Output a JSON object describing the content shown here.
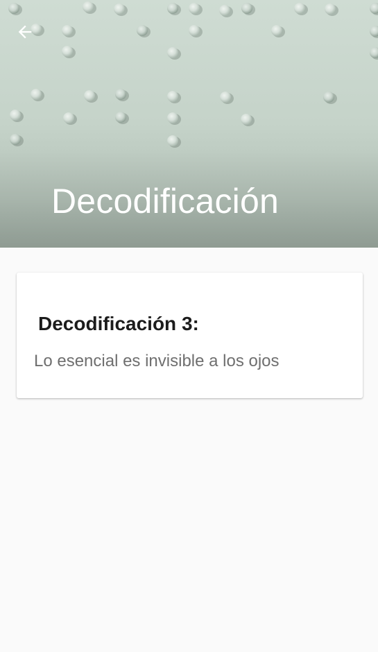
{
  "header": {
    "title": "Decodificación",
    "back_icon": "arrow-back-icon",
    "background_image": "braille-dots-photo"
  },
  "card": {
    "title": "Decodificación 3:",
    "body": "Lo esencial es invisible a los ojos"
  },
  "colors": {
    "page_background": "#fafafa",
    "hero_tint": "#c5d3c9",
    "title_text": "#ffffff",
    "card_title_text": "#1c1c1c",
    "card_body_text": "#6f6f6f"
  }
}
